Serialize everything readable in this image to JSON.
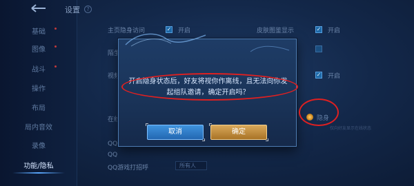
{
  "sidebar": {
    "back_icon": "back-arrow-icon",
    "items": [
      {
        "label": "基础",
        "has_dot": true
      },
      {
        "label": "图像",
        "has_dot": true
      },
      {
        "label": "战斗",
        "has_dot": true
      },
      {
        "label": "操作",
        "has_dot": false
      },
      {
        "label": "布局",
        "has_dot": false
      },
      {
        "label": "局内音效",
        "has_dot": false
      },
      {
        "label": "录像",
        "has_dot": false
      },
      {
        "label": "功能/隐私",
        "has_dot": false,
        "active": true
      },
      {
        "label": "",
        "has_dot": false
      }
    ]
  },
  "header": {
    "title": "设置",
    "help_icon": "?"
  },
  "settings": {
    "stealth_label": "主页隐身访问",
    "stealth_option": "开启",
    "skin_label": "皮肤图鉴显示",
    "skin_option": "开启",
    "row3_label": "陌生",
    "row4_label": "视频",
    "row4_right_option": "开启",
    "row5_label": "在线",
    "row5_right_option": "隐身",
    "row5_hint": "仅向好友显示在线状态",
    "qq_label": "QQ",
    "qq2_label": "QQ",
    "qq_game_label": "QQ游戏打招呼",
    "qq_game_value": "所有人"
  },
  "modal": {
    "message": "开启隐身状态后，好友将视你作离线，且无法向你发起组队邀请，确定开启吗？",
    "cancel_label": "取消",
    "confirm_label": "确定"
  },
  "colors": {
    "cancel_button": "#2f80cc",
    "confirm_button": "#c8923f",
    "annotation": "#e02020"
  }
}
